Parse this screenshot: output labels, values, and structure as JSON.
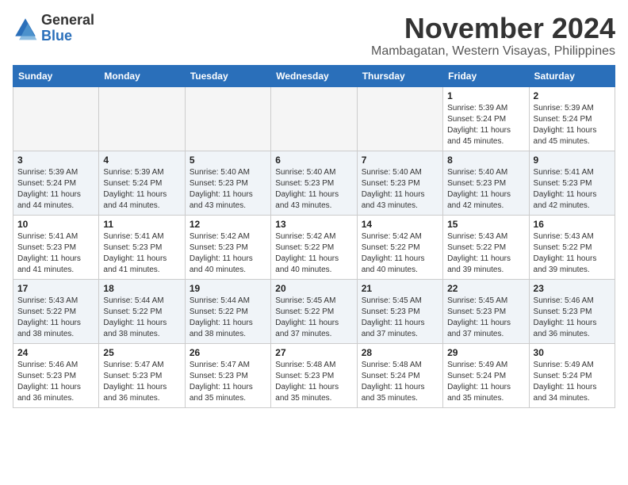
{
  "logo": {
    "general": "General",
    "blue": "Blue"
  },
  "header": {
    "month": "November 2024",
    "location": "Mambagatan, Western Visayas, Philippines"
  },
  "weekdays": [
    "Sunday",
    "Monday",
    "Tuesday",
    "Wednesday",
    "Thursday",
    "Friday",
    "Saturday"
  ],
  "weeks": [
    [
      {
        "day": "",
        "info": ""
      },
      {
        "day": "",
        "info": ""
      },
      {
        "day": "",
        "info": ""
      },
      {
        "day": "",
        "info": ""
      },
      {
        "day": "",
        "info": ""
      },
      {
        "day": "1",
        "info": "Sunrise: 5:39 AM\nSunset: 5:24 PM\nDaylight: 11 hours and 45 minutes."
      },
      {
        "day": "2",
        "info": "Sunrise: 5:39 AM\nSunset: 5:24 PM\nDaylight: 11 hours and 45 minutes."
      }
    ],
    [
      {
        "day": "3",
        "info": "Sunrise: 5:39 AM\nSunset: 5:24 PM\nDaylight: 11 hours and 44 minutes."
      },
      {
        "day": "4",
        "info": "Sunrise: 5:39 AM\nSunset: 5:24 PM\nDaylight: 11 hours and 44 minutes."
      },
      {
        "day": "5",
        "info": "Sunrise: 5:40 AM\nSunset: 5:23 PM\nDaylight: 11 hours and 43 minutes."
      },
      {
        "day": "6",
        "info": "Sunrise: 5:40 AM\nSunset: 5:23 PM\nDaylight: 11 hours and 43 minutes."
      },
      {
        "day": "7",
        "info": "Sunrise: 5:40 AM\nSunset: 5:23 PM\nDaylight: 11 hours and 43 minutes."
      },
      {
        "day": "8",
        "info": "Sunrise: 5:40 AM\nSunset: 5:23 PM\nDaylight: 11 hours and 42 minutes."
      },
      {
        "day": "9",
        "info": "Sunrise: 5:41 AM\nSunset: 5:23 PM\nDaylight: 11 hours and 42 minutes."
      }
    ],
    [
      {
        "day": "10",
        "info": "Sunrise: 5:41 AM\nSunset: 5:23 PM\nDaylight: 11 hours and 41 minutes."
      },
      {
        "day": "11",
        "info": "Sunrise: 5:41 AM\nSunset: 5:23 PM\nDaylight: 11 hours and 41 minutes."
      },
      {
        "day": "12",
        "info": "Sunrise: 5:42 AM\nSunset: 5:23 PM\nDaylight: 11 hours and 40 minutes."
      },
      {
        "day": "13",
        "info": "Sunrise: 5:42 AM\nSunset: 5:22 PM\nDaylight: 11 hours and 40 minutes."
      },
      {
        "day": "14",
        "info": "Sunrise: 5:42 AM\nSunset: 5:22 PM\nDaylight: 11 hours and 40 minutes."
      },
      {
        "day": "15",
        "info": "Sunrise: 5:43 AM\nSunset: 5:22 PM\nDaylight: 11 hours and 39 minutes."
      },
      {
        "day": "16",
        "info": "Sunrise: 5:43 AM\nSunset: 5:22 PM\nDaylight: 11 hours and 39 minutes."
      }
    ],
    [
      {
        "day": "17",
        "info": "Sunrise: 5:43 AM\nSunset: 5:22 PM\nDaylight: 11 hours and 38 minutes."
      },
      {
        "day": "18",
        "info": "Sunrise: 5:44 AM\nSunset: 5:22 PM\nDaylight: 11 hours and 38 minutes."
      },
      {
        "day": "19",
        "info": "Sunrise: 5:44 AM\nSunset: 5:22 PM\nDaylight: 11 hours and 38 minutes."
      },
      {
        "day": "20",
        "info": "Sunrise: 5:45 AM\nSunset: 5:22 PM\nDaylight: 11 hours and 37 minutes."
      },
      {
        "day": "21",
        "info": "Sunrise: 5:45 AM\nSunset: 5:23 PM\nDaylight: 11 hours and 37 minutes."
      },
      {
        "day": "22",
        "info": "Sunrise: 5:45 AM\nSunset: 5:23 PM\nDaylight: 11 hours and 37 minutes."
      },
      {
        "day": "23",
        "info": "Sunrise: 5:46 AM\nSunset: 5:23 PM\nDaylight: 11 hours and 36 minutes."
      }
    ],
    [
      {
        "day": "24",
        "info": "Sunrise: 5:46 AM\nSunset: 5:23 PM\nDaylight: 11 hours and 36 minutes."
      },
      {
        "day": "25",
        "info": "Sunrise: 5:47 AM\nSunset: 5:23 PM\nDaylight: 11 hours and 36 minutes."
      },
      {
        "day": "26",
        "info": "Sunrise: 5:47 AM\nSunset: 5:23 PM\nDaylight: 11 hours and 35 minutes."
      },
      {
        "day": "27",
        "info": "Sunrise: 5:48 AM\nSunset: 5:23 PM\nDaylight: 11 hours and 35 minutes."
      },
      {
        "day": "28",
        "info": "Sunrise: 5:48 AM\nSunset: 5:24 PM\nDaylight: 11 hours and 35 minutes."
      },
      {
        "day": "29",
        "info": "Sunrise: 5:49 AM\nSunset: 5:24 PM\nDaylight: 11 hours and 35 minutes."
      },
      {
        "day": "30",
        "info": "Sunrise: 5:49 AM\nSunset: 5:24 PM\nDaylight: 11 hours and 34 minutes."
      }
    ]
  ]
}
